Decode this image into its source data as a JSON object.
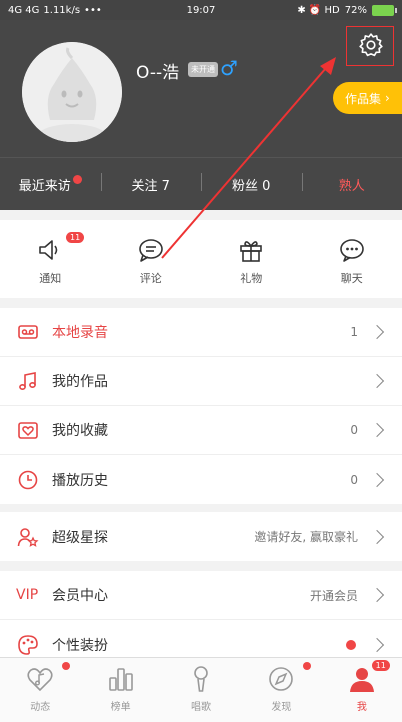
{
  "status_bar": {
    "network": "4G 4G",
    "speed": "1.11k/s",
    "dots": "•••",
    "time": "19:07",
    "icons": "✱ ⏰ HD",
    "battery": "72%"
  },
  "profile": {
    "username": "O--浩",
    "badge": "未开通",
    "gender_symbol": "♂",
    "works_button": "作品集"
  },
  "stats": {
    "recent_visitors": "最近来访",
    "following": "关注 7",
    "followers": "粉丝 0",
    "acquaintances": "熟人"
  },
  "quick_actions": [
    {
      "label": "通知",
      "badge": "11"
    },
    {
      "label": "评论"
    },
    {
      "label": "礼物"
    },
    {
      "label": "聊天"
    }
  ],
  "menu": {
    "local_recording": {
      "label": "本地录音",
      "value": "1"
    },
    "my_works": {
      "label": "我的作品"
    },
    "my_favorites": {
      "label": "我的收藏",
      "value": "0"
    },
    "play_history": {
      "label": "播放历史",
      "value": "0"
    },
    "super_scout": {
      "label": "超级星探",
      "value": "邀请好友, 赢取豪礼"
    },
    "vip_center": {
      "label": "会员中心",
      "icon_text": "VIP",
      "value": "开通会员"
    },
    "personal_style": {
      "label": "个性装扮"
    }
  },
  "tabs": [
    {
      "label": "动态"
    },
    {
      "label": "榜单"
    },
    {
      "label": "唱歌"
    },
    {
      "label": "发现"
    },
    {
      "label": "我",
      "badge": "11"
    }
  ],
  "colors": {
    "accent": "#e64545",
    "header_bg": "#474747",
    "works_button": "#ffc107",
    "gender": "#2ea2ff"
  }
}
